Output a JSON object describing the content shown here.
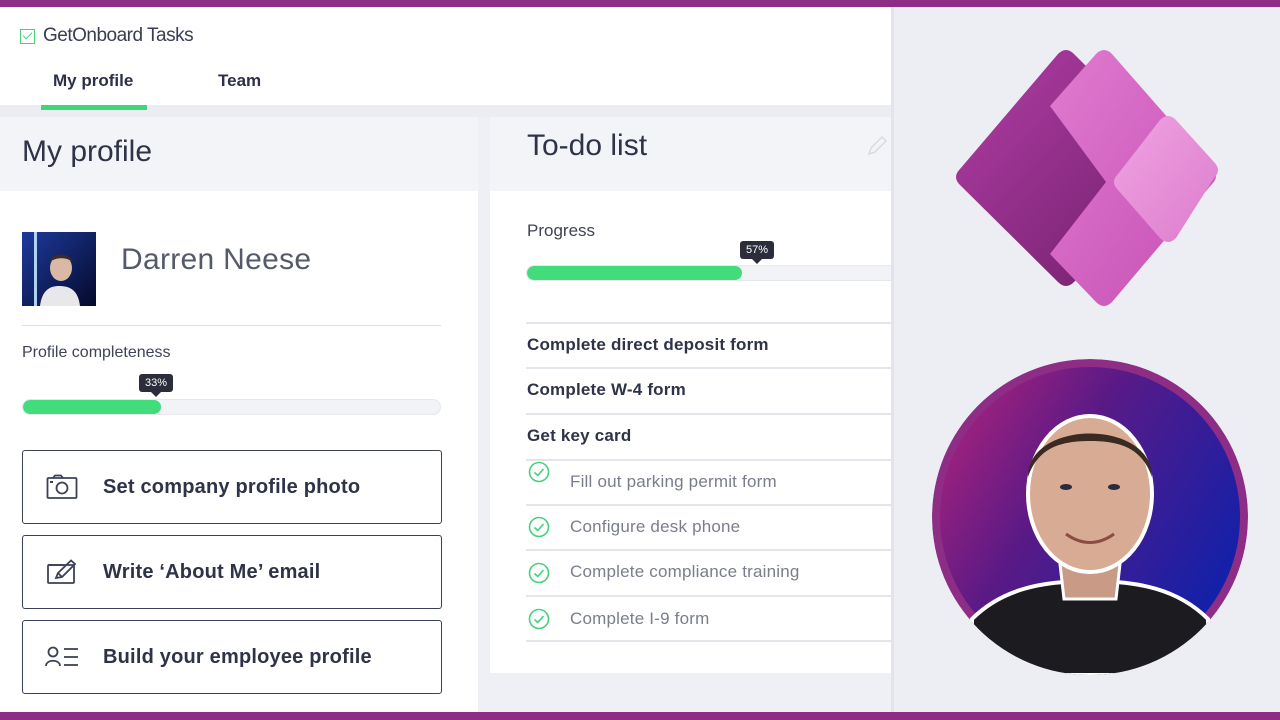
{
  "app": {
    "brand": "GetOnboard Tasks",
    "tabs": [
      {
        "label": "My profile",
        "active": true
      },
      {
        "label": "Team",
        "active": false
      }
    ]
  },
  "profile": {
    "title": "My profile",
    "name": "Darren Neese",
    "completeness_label": "Profile completeness",
    "completeness_value": 33,
    "completeness_text": "33%",
    "actions": [
      {
        "label": "Set company profile photo",
        "icon": "camera-icon"
      },
      {
        "label": "Write ‘About Me’ email",
        "icon": "edit-note-icon"
      },
      {
        "label": "Build your employee profile",
        "icon": "contact-list-icon"
      }
    ]
  },
  "todo": {
    "title": "To-do list",
    "progress_label": "Progress",
    "progress_value": 57,
    "progress_text": "57%",
    "items": [
      {
        "label": "Complete direct deposit form",
        "done": false
      },
      {
        "label": "Complete W-4 form",
        "done": false
      },
      {
        "label": "Get key card",
        "done": false
      },
      {
        "label": "Fill out parking permit form",
        "done": true
      },
      {
        "label": "Configure desk phone",
        "done": true
      },
      {
        "label": "Complete compliance training",
        "done": true
      },
      {
        "label": "Complete I-9 form",
        "done": true
      }
    ]
  },
  "colors": {
    "frame": "#8e2d86",
    "accent_green": "#42dc7c",
    "text_dark": "#2f3348"
  }
}
